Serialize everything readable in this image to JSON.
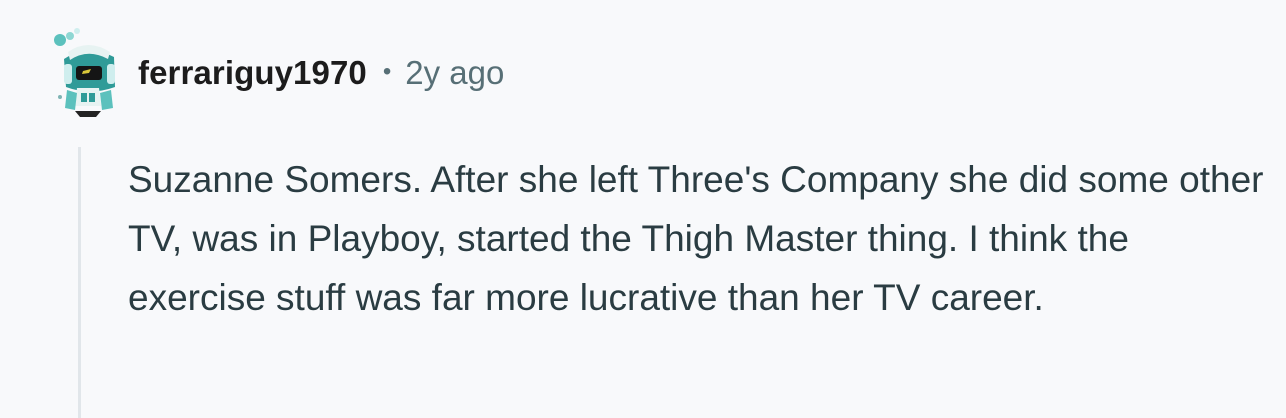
{
  "comment": {
    "author": {
      "username": "ferrariguy1970",
      "avatar_icon": "robot-avatar-icon"
    },
    "separator": "•",
    "timestamp": "2y ago",
    "body": "Suzanne Somers. After she left Three's Company she did some other TV, was in Playboy, started the Thigh Master thing. I think the exercise stuff was far more lucrative than her TV career."
  },
  "colors": {
    "background": "#f8f9fb",
    "username": "#1c1c1c",
    "meta": "#576f76",
    "body_text": "#2a3c42",
    "thread_line": "#e1e6ea",
    "avatar_accent": "#2f9b98"
  }
}
